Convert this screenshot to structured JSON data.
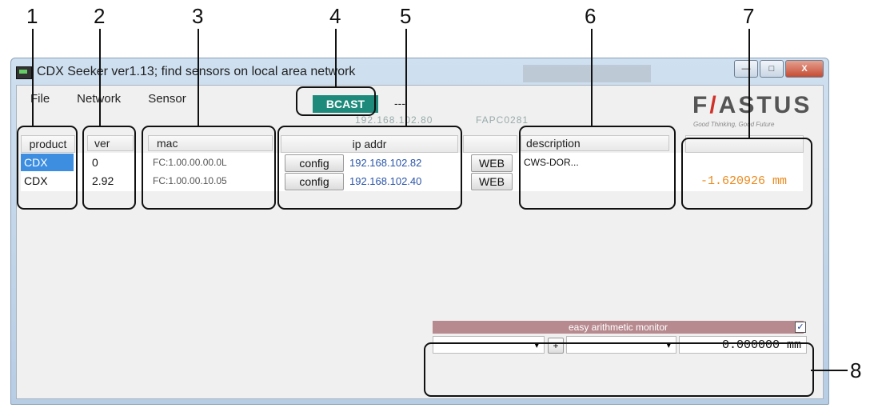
{
  "callouts": [
    "1",
    "2",
    "3",
    "4",
    "5",
    "6",
    "7",
    "8"
  ],
  "window": {
    "title": "CDX Seeker ver1.13; find sensors on local area network",
    "controls": {
      "minimize": "—",
      "maximize": "□",
      "close": "X"
    }
  },
  "menu": [
    "File",
    "Network",
    "Sensor"
  ],
  "toolbar": {
    "bcast_label": "BCAST",
    "dashes": "---",
    "ip_blurred": "192.168.102.80",
    "id_blurred": "FAPC0281"
  },
  "logo": {
    "text_a": "F",
    "slash": "/",
    "text_b": "ASTUS",
    "tagline": "Good Thinking, Good Future"
  },
  "table": {
    "headers": {
      "product": "product",
      "ver": "ver",
      "mac": "mac",
      "ip": "ip addr",
      "description": "description",
      "value": ""
    },
    "rows": [
      {
        "product": "CDX",
        "ver": "0",
        "mac": "FC:1.00.00.00.0L",
        "config": "config",
        "ip": "192.168.102.82",
        "web": "WEB",
        "description": "CWS-DOR...",
        "value": ""
      },
      {
        "product": "CDX",
        "ver": "2.92",
        "mac": "FC:1.00.00.10.05",
        "config": "config",
        "ip": "192.168.102.40",
        "web": "WEB",
        "description": "",
        "value": "-1.620926 mm"
      }
    ]
  },
  "monitor": {
    "title": "easy arithmetic monitor",
    "checked_mark": "✓",
    "dropdown_arrow": "▾",
    "plus": "+",
    "value": "0.000000 mm"
  },
  "colors": {
    "bcast": "#1d8a7c",
    "selected": "#3d8ee0",
    "value": "#ec8a1e",
    "monitor_header": "#b78a8f"
  }
}
